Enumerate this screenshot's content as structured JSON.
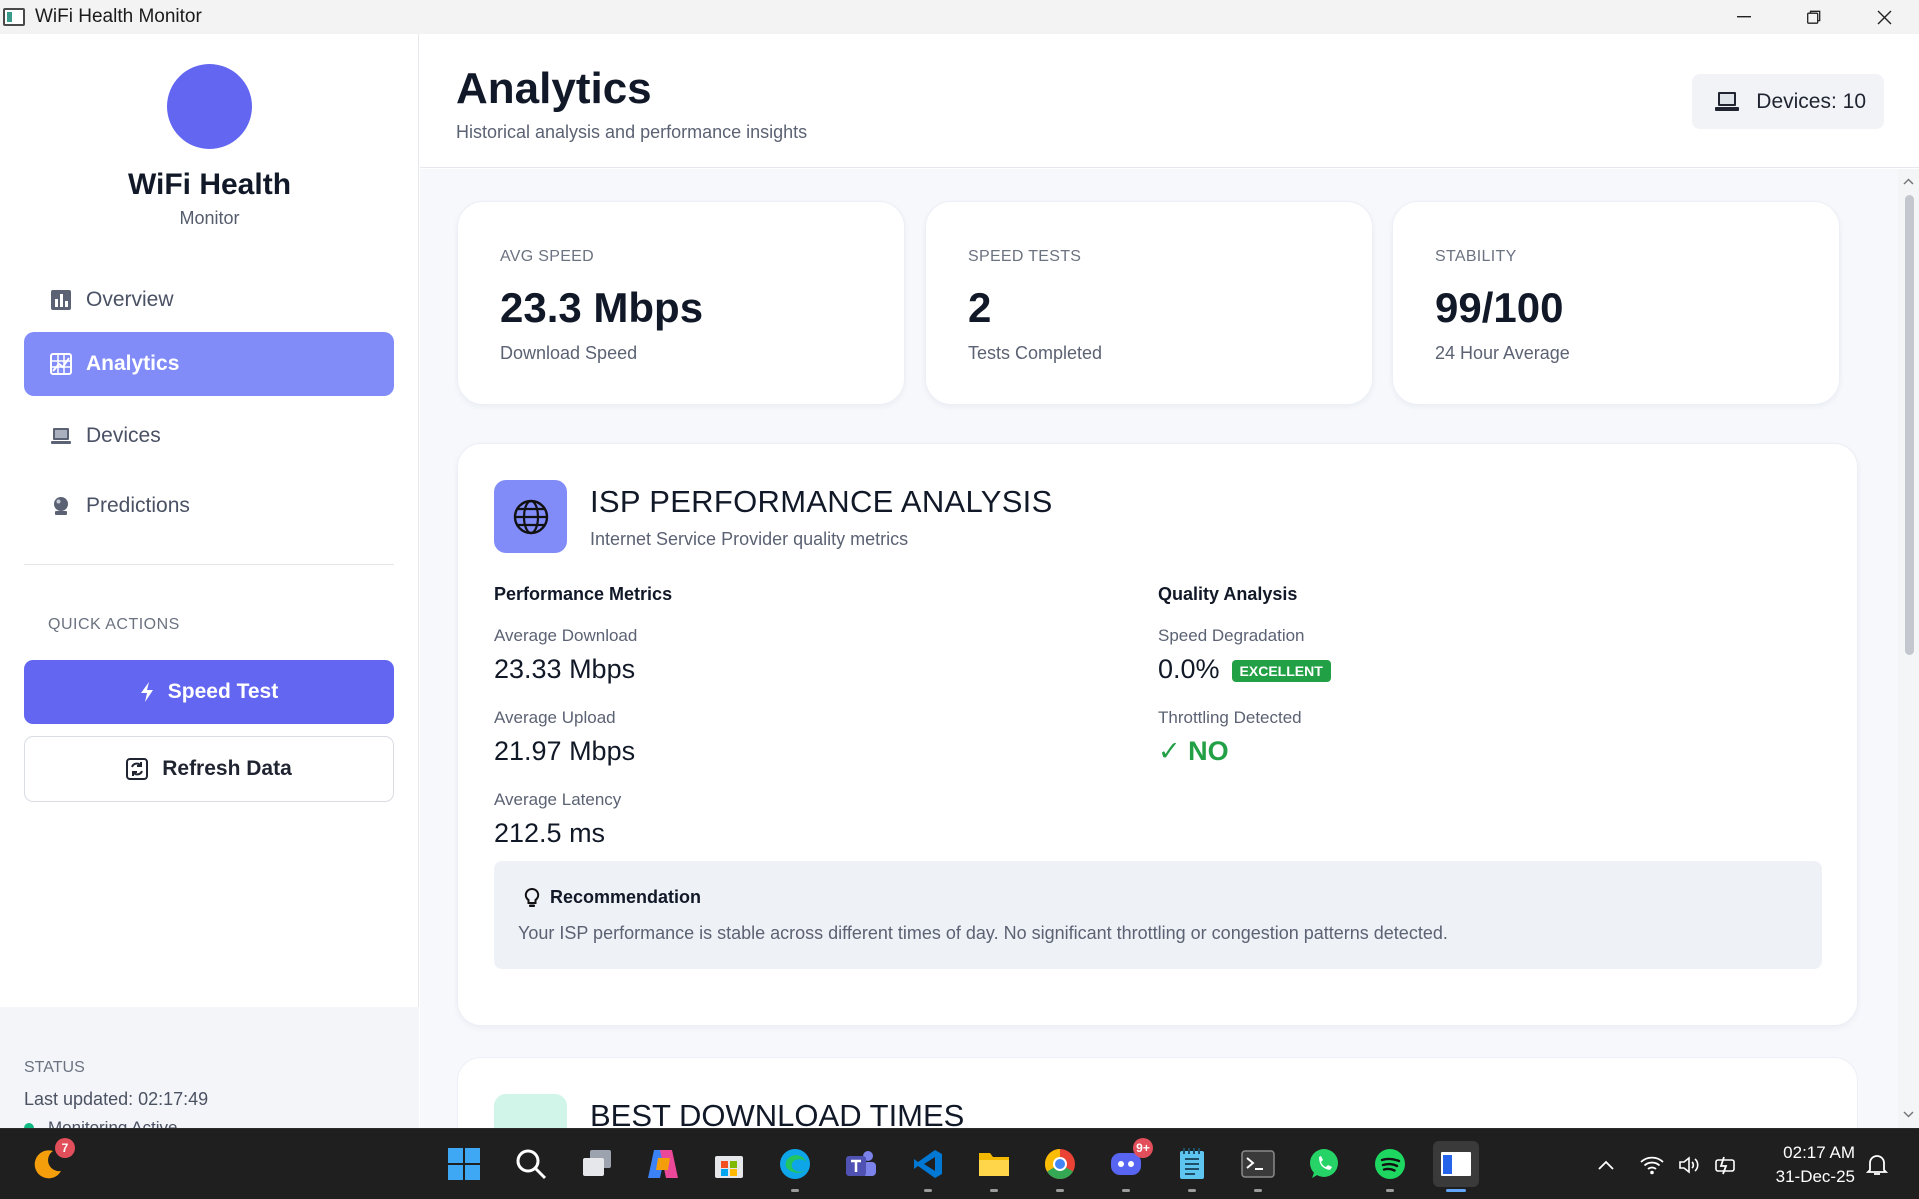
{
  "window": {
    "title": "WiFi Health Monitor"
  },
  "sidebar": {
    "brand_title": "WiFi Health",
    "brand_sub": "Monitor",
    "nav": [
      {
        "label": "Overview",
        "icon": "bar-chart-icon",
        "active": false
      },
      {
        "label": "Analytics",
        "icon": "chart-grid-icon",
        "active": true
      },
      {
        "label": "Devices",
        "icon": "laptop-icon",
        "active": false
      },
      {
        "label": "Predictions",
        "icon": "crystal-ball-icon",
        "active": false
      }
    ],
    "quick_actions_label": "QUICK ACTIONS",
    "speed_test_label": "Speed Test",
    "refresh_label": "Refresh Data",
    "status": {
      "label": "STATUS",
      "last_updated": "Last updated: 02:17:49",
      "monitoring": "Monitoring Active",
      "monitoring_color": "#10b981"
    }
  },
  "header": {
    "title": "Analytics",
    "subtitle": "Historical analysis and performance insights",
    "devices": "Devices: 10"
  },
  "stats": [
    {
      "label": "AVG SPEED",
      "value": "23.3 Mbps",
      "sub": "Download Speed"
    },
    {
      "label": "SPEED TESTS",
      "value": "2",
      "sub": "Tests Completed"
    },
    {
      "label": "STABILITY",
      "value": "99/100",
      "sub": "24 Hour Average"
    }
  ],
  "isp": {
    "title": "ISP PERFORMANCE ANALYSIS",
    "subtitle": "Internet Service Provider quality metrics",
    "perf_heading": "Performance Metrics",
    "quality_heading": "Quality Analysis",
    "avg_download_label": "Average Download",
    "avg_download": "23.33 Mbps",
    "avg_upload_label": "Average Upload",
    "avg_upload": "21.97 Mbps",
    "avg_latency_label": "Average Latency",
    "avg_latency": "212.5 ms",
    "degradation_label": "Speed Degradation",
    "degradation": "0.0%",
    "degradation_badge": "EXCELLENT",
    "throttling_label": "Throttling Detected",
    "throttling": "✓ NO",
    "recommendation_title": "Recommendation",
    "recommendation_text": "Your ISP performance is stable across different times of day. No significant throttling or congestion patterns detected.",
    "accent": "#818cf8",
    "good_color": "#22a045"
  },
  "best_times": {
    "title": "BEST DOWNLOAD TIMES"
  },
  "taskbar": {
    "notification_count": "7",
    "discord_badge": "9+",
    "time": "02:17 AM",
    "date": "31-Dec-25"
  }
}
